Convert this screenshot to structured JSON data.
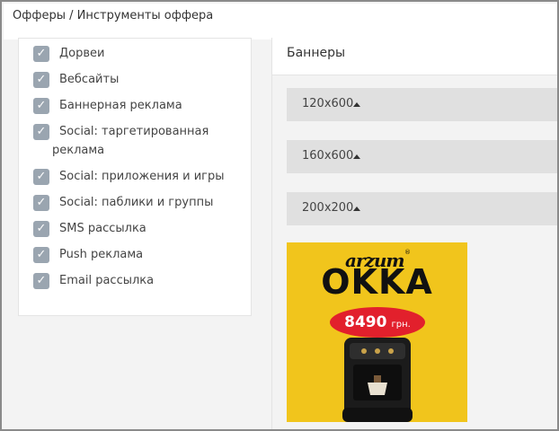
{
  "breadcrumb": "Офферы / Инструменты оффера",
  "traffic_sources": [
    {
      "label": "Дорвеи",
      "checked": true
    },
    {
      "label": "Вебсайты",
      "checked": true
    },
    {
      "label": "Баннерная реклама",
      "checked": true
    },
    {
      "label": "Social: таргетированная",
      "label_cont": "реклама",
      "checked": true
    },
    {
      "label": "Social: приложения и игры",
      "checked": true
    },
    {
      "label": "Social: паблики и группы",
      "checked": true
    },
    {
      "label": "SMS рассылка",
      "checked": true
    },
    {
      "label": "Push реклама",
      "checked": true
    },
    {
      "label": "Email рассылка",
      "checked": true
    }
  ],
  "check_glyph": "✓",
  "banners": {
    "title": "Баннеры",
    "sizes": [
      {
        "label": "120x600",
        "expanded": true
      },
      {
        "label": "160x600",
        "expanded": true
      },
      {
        "label": "200x200",
        "expanded": true
      }
    ],
    "ad": {
      "brand": "arzum",
      "brand_mark": "®",
      "product": "OKKA",
      "price": "8490",
      "currency": "грн."
    }
  },
  "colors": {
    "checkbox": "#9aa5b0",
    "size_row": "#e0e0e0",
    "banner_bg": "#f1c51c",
    "price_pill": "#e2202c"
  }
}
